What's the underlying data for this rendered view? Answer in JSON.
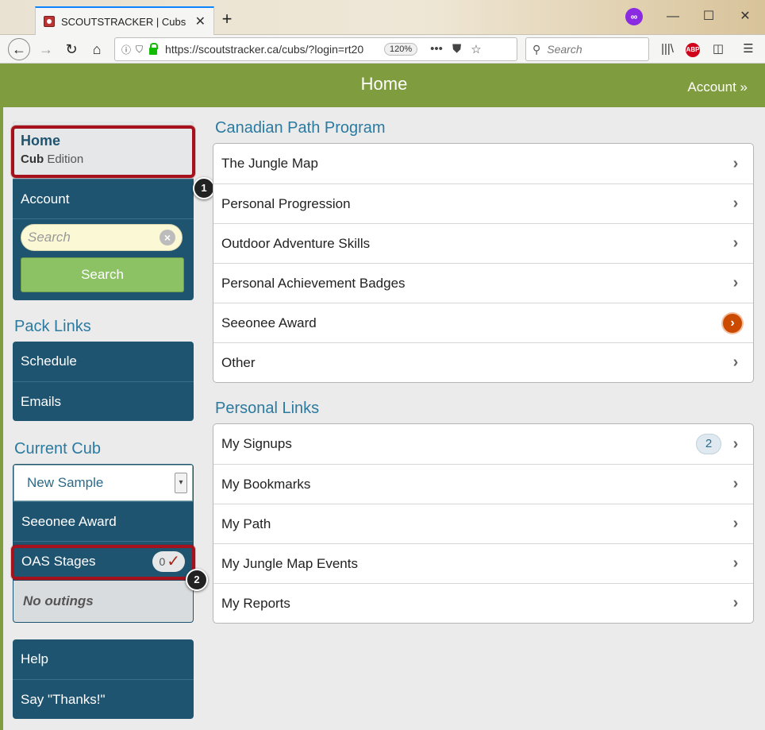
{
  "browser": {
    "tab_title": "SCOUTSTRACKER | Cubs",
    "tab_close": "✕",
    "new_tab": "+",
    "url": "https://scoutstracker.ca/cubs/?login=rt20",
    "zoom": "120%",
    "search_placeholder": "Search"
  },
  "header": {
    "title": "Home",
    "account_link": "Account »"
  },
  "sidebar": {
    "home_title": "Home",
    "home_sub_bold": "Cub",
    "home_sub_rest": " Edition",
    "account": "Account",
    "search_placeholder": "Search",
    "search_button": "Search",
    "pack_links_heading": "Pack Links",
    "pack_links": [
      "Schedule",
      "Emails"
    ],
    "current_cub_heading": "Current Cub",
    "current_cub_value": "New Sample",
    "seeonee_award": "Seeonee Award",
    "oas_stages": "OAS Stages",
    "oas_count": "0",
    "no_outings": "No outings",
    "footer_links": [
      "Help",
      "Say \"Thanks!\""
    ]
  },
  "main": {
    "canadian_path_heading": "Canadian Path Program",
    "canadian_path_items": [
      "The Jungle Map",
      "Personal Progression",
      "Outdoor Adventure Skills",
      "Personal Achievement Badges",
      "Seeonee Award",
      "Other"
    ],
    "personal_links_heading": "Personal Links",
    "personal_links_items": [
      "My Signups",
      "My Bookmarks",
      "My Path",
      "My Jungle Map Events",
      "My Reports"
    ],
    "signups_count": "2"
  },
  "annotations": [
    "1",
    "2"
  ],
  "colors": {
    "header_green": "#7f9d3f",
    "sidebar_blue": "#1f5470",
    "link_blue": "#2b7aa0",
    "search_green": "#8cc263",
    "annotation_red": "#a5121d",
    "seeonee_orange": "#cc4a00"
  }
}
